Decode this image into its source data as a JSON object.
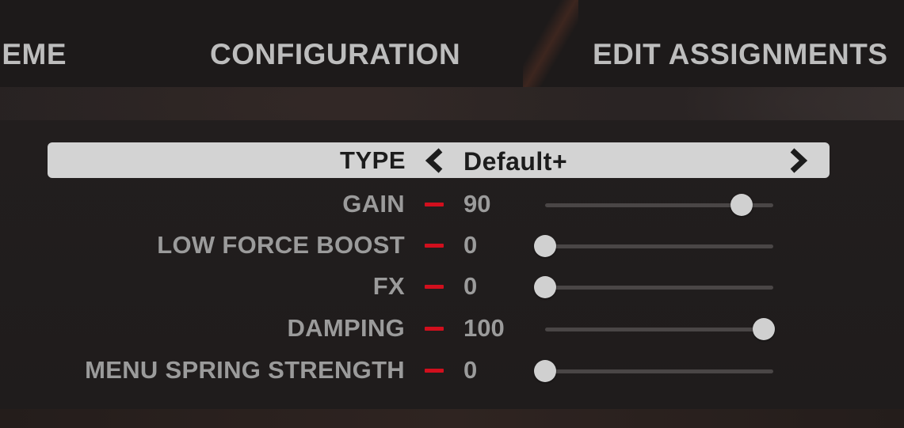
{
  "tabs": [
    {
      "label": "THEME"
    },
    {
      "label": "CONFIGURATION"
    },
    {
      "label": "EDIT ASSIGNMENTS"
    }
  ],
  "type_selector": {
    "label": "TYPE",
    "value": "Default+",
    "prev_icon": "chevron-left-icon",
    "next_icon": "chevron-right-icon"
  },
  "settings": [
    {
      "label": "GAIN",
      "value": "90",
      "level": 0.9
    },
    {
      "label": "LOW FORCE BOOST",
      "value": "0",
      "level": 0.0
    },
    {
      "label": "FX",
      "value": "0",
      "level": 0.0
    },
    {
      "label": "DAMPING",
      "value": "100",
      "level": 1.0
    },
    {
      "label": "MENU SPRING STRENGTH",
      "value": "0",
      "level": 0.0
    }
  ],
  "colors": {
    "decrement_accent": "#d10f1d",
    "selector_background": "#d3d3d3",
    "label_text": "#9b9b9b",
    "tab_text": "#bdbdbd",
    "slider_knob": "#d0d0d0",
    "slider_track": "#4a4646"
  }
}
